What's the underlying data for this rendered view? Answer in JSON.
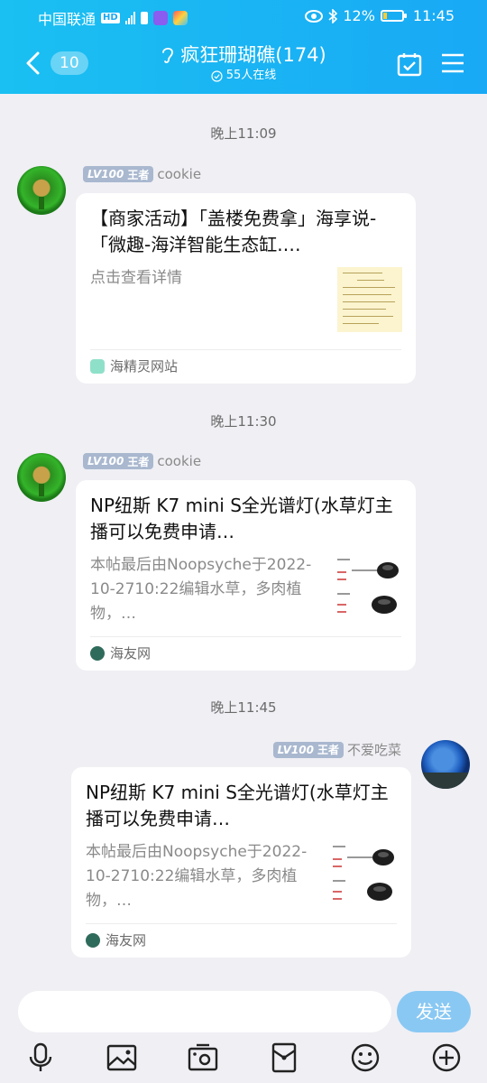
{
  "status_bar": {
    "carrier": "中国联通",
    "hd": "HD",
    "network": "4G",
    "battery_pct": "12%",
    "time": "11:45"
  },
  "header": {
    "unread_count": "10",
    "group_title": "疯狂珊瑚礁(174)",
    "online_text": "55人在线"
  },
  "messages": [
    {
      "time": "晚上11:09",
      "level": "LV100",
      "rank": "王者",
      "sender": "cookie",
      "card": {
        "title": "【商家活动】「盖楼免费拿」海享说-「微趣-海洋智能生态缸.…",
        "desc": "点击查看详情",
        "source": "海精灵网站"
      }
    },
    {
      "time": "晚上11:30",
      "level": "LV100",
      "rank": "王者",
      "sender": "cookie",
      "card": {
        "title": "NP纽斯 K7 mini S全光谱灯(水草灯主播可以免费申请…",
        "desc": "本帖最后由Noopsyche于2022-10-2710:22编辑水草，多肉植物，…",
        "source": "海友网"
      }
    },
    {
      "time": "晚上11:45",
      "level": "LV100",
      "rank": "王者",
      "sender": "不爱吃菜",
      "card": {
        "title": "NP纽斯 K7 mini S全光谱灯(水草灯主播可以免费申请…",
        "desc": "本帖最后由Noopsyche于2022-10-2710:22编辑水草，多肉植物，…",
        "source": "海友网"
      }
    }
  ],
  "composer": {
    "send_label": "发送"
  },
  "toolbar_icons": [
    "microphone-icon",
    "image-icon",
    "camera-icon",
    "red-packet-icon",
    "emoji-icon",
    "plus-icon"
  ],
  "colors": {
    "header": "#19a9f5",
    "background": "#efeff4",
    "send_button": "#89c8f3",
    "level_badge": "#a9b8cf"
  }
}
